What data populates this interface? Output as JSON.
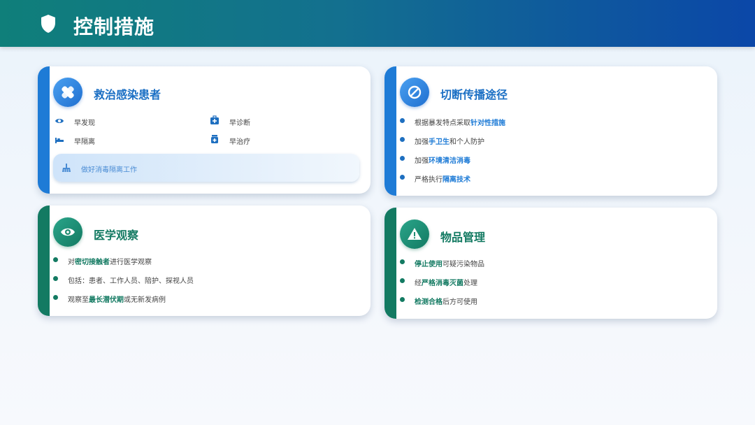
{
  "header": {
    "title": "控制措施",
    "icon": "shield-icon"
  },
  "cards": {
    "treat": {
      "title": "救治感染患者",
      "icon": "bandage-icon",
      "items": [
        {
          "label": "早发现",
          "icon": "eye-icon"
        },
        {
          "label": "早诊断",
          "icon": "medical-kit-icon"
        },
        {
          "label": "早隔离",
          "icon": "bed-icon"
        },
        {
          "label": "早治疗",
          "icon": "medicine-bottle-icon"
        }
      ],
      "highlight": {
        "label": "做好消毒隔离工作",
        "icon": "broom-icon"
      }
    },
    "cut": {
      "title": "切断传播途径",
      "icon": "ban-icon",
      "bullets": [
        {
          "pre": "根据暴发特点采取",
          "hl": "针对性措施",
          "post": ""
        },
        {
          "pre": "加强",
          "hl": "手卫生",
          "post": "和个人防护"
        },
        {
          "pre": "加强",
          "hl": "环境清洁消毒",
          "post": ""
        },
        {
          "pre": "严格执行",
          "hl": "隔离技术",
          "post": ""
        }
      ]
    },
    "observe": {
      "title": "医学观察",
      "icon": "eye-icon",
      "bullets": [
        {
          "pre": "对",
          "hl": "密切接触者",
          "post": "进行医学观察"
        },
        {
          "pre": "包括：患者、工作人员、陪护、探视人员",
          "hl": "",
          "post": ""
        },
        {
          "pre": "观察至",
          "hl": "最长潜伏期",
          "post": "或无新发病例"
        }
      ]
    },
    "goods": {
      "title": "物品管理",
      "icon": "warning-icon",
      "bullets": [
        {
          "pre": "",
          "hl": "停止使用",
          "post": "可疑污染物品"
        },
        {
          "pre": "经",
          "hl": "严格消毒灭菌",
          "post": "处理"
        },
        {
          "pre": "",
          "hl": "检测合格",
          "post": "后方可使用"
        }
      ]
    }
  },
  "colors": {
    "blue": "#1e7bd6",
    "green": "#137a62",
    "header_start": "#0f7f7a",
    "header_end": "#0b47a8"
  }
}
